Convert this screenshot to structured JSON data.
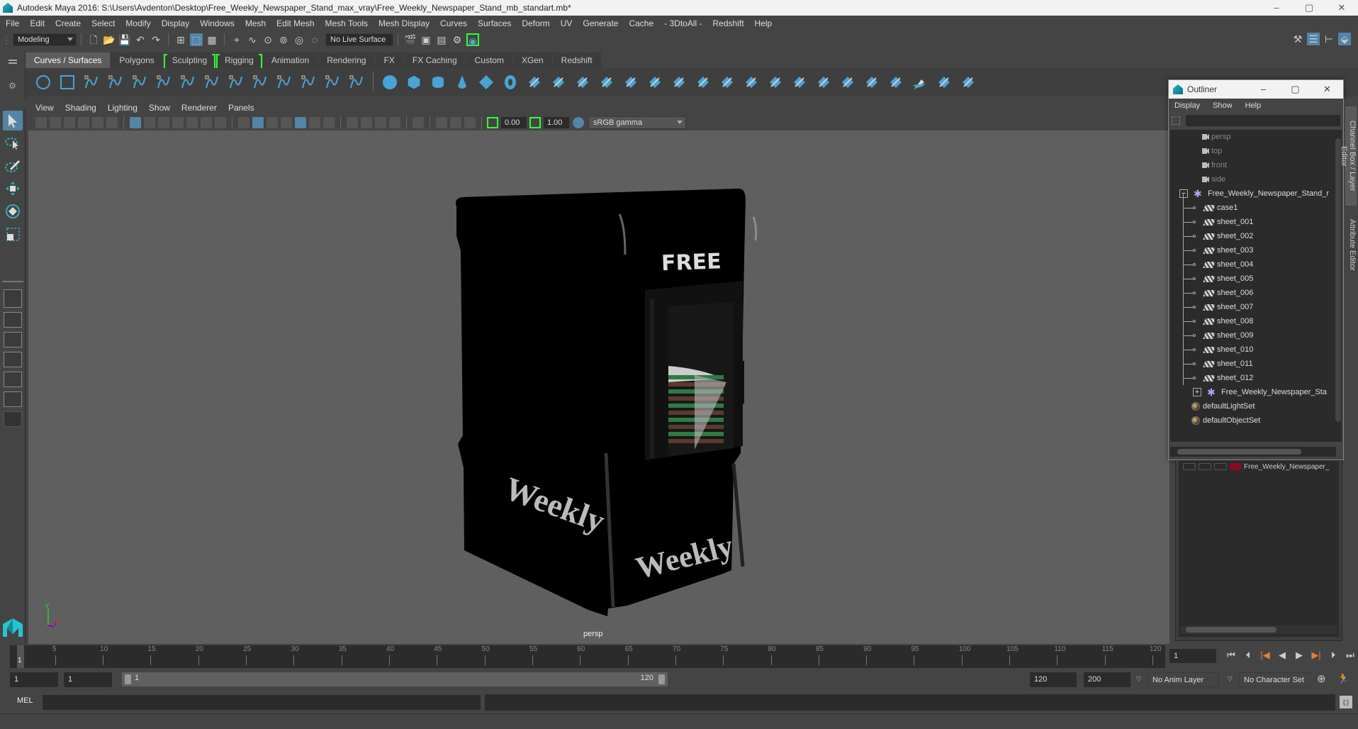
{
  "window": {
    "title": "Autodesk Maya 2016: S:\\Users\\Avdenton\\Desktop\\Free_Weekly_Newspaper_Stand_max_vray\\Free_Weekly_Newspaper_Stand_mb_standart.mb*",
    "minimize": "–",
    "maximize": "▢",
    "close": "✕"
  },
  "menubar": [
    "File",
    "Edit",
    "Create",
    "Select",
    "Modify",
    "Display",
    "Windows",
    "Mesh",
    "Edit Mesh",
    "Mesh Tools",
    "Mesh Display",
    "Curves",
    "Surfaces",
    "Deform",
    "UV",
    "Generate",
    "Cache",
    "- 3DtoAll -",
    "Redshift",
    "Help"
  ],
  "statusline": {
    "mode": "Modeling",
    "live_surface": "No Live Surface"
  },
  "shelf": {
    "tabs": [
      "Curves / Surfaces",
      "Polygons",
      "Sculpting",
      "Rigging",
      "Animation",
      "Rendering",
      "FX",
      "FX Caching",
      "Custom",
      "XGen",
      "Redshift"
    ],
    "active_tab": "Curves / Surfaces",
    "icons": [
      "nurbs-circle",
      "nurbs-square",
      "ep-curve",
      "pencil-curve",
      "cv-curve",
      "arc",
      "curve-edit",
      "curve-attach",
      "curve-detach",
      "bezier",
      "curve-rebuild",
      "curve-insert",
      "curve-cut",
      "curve-fillet",
      "poly-sphere",
      "poly-cube",
      "poly-cylinder",
      "poly-cone",
      "poly-diamond",
      "poly-torus",
      "revolve",
      "loft",
      "planar",
      "extrude",
      "birail",
      "boundary",
      "square",
      "bevel",
      "surface-fillet",
      "intersect",
      "project",
      "trim",
      "untrim",
      "stitch",
      "attach",
      "detach",
      "rebuild",
      "sculpt",
      "surface-cut"
    ]
  },
  "viewport": {
    "menu": [
      "View",
      "Shading",
      "Lighting",
      "Show",
      "Renderer",
      "Panels"
    ],
    "exposure": "0.00",
    "gamma": "1.00",
    "color_space": "sRGB gamma",
    "camera_label": "persp",
    "model_texts": {
      "top": "FREE",
      "left": "Weekly",
      "front": "Weekly"
    }
  },
  "outliner": {
    "title": "Outliner",
    "menu": [
      "Display",
      "Show",
      "Help"
    ],
    "items": [
      {
        "label": "persp",
        "type": "camera",
        "indent": 0
      },
      {
        "label": "top",
        "type": "camera",
        "indent": 0
      },
      {
        "label": "front",
        "type": "camera",
        "indent": 0
      },
      {
        "label": "side",
        "type": "camera",
        "indent": 0
      },
      {
        "label": "Free_Weekly_Newspaper_Stand_r",
        "type": "group",
        "indent": 0,
        "expanded": true
      },
      {
        "label": "case1",
        "type": "mesh",
        "indent": 1
      },
      {
        "label": "sheet_001",
        "type": "mesh",
        "indent": 1
      },
      {
        "label": "sheet_002",
        "type": "mesh",
        "indent": 1
      },
      {
        "label": "sheet_003",
        "type": "mesh",
        "indent": 1
      },
      {
        "label": "sheet_004",
        "type": "mesh",
        "indent": 1
      },
      {
        "label": "sheet_005",
        "type": "mesh",
        "indent": 1
      },
      {
        "label": "sheet_006",
        "type": "mesh",
        "indent": 1
      },
      {
        "label": "sheet_007",
        "type": "mesh",
        "indent": 1
      },
      {
        "label": "sheet_008",
        "type": "mesh",
        "indent": 1
      },
      {
        "label": "sheet_009",
        "type": "mesh",
        "indent": 1
      },
      {
        "label": "sheet_010",
        "type": "mesh",
        "indent": 1
      },
      {
        "label": "sheet_011",
        "type": "mesh",
        "indent": 1
      },
      {
        "label": "sheet_012",
        "type": "mesh",
        "indent": 1
      },
      {
        "label": "Free_Weekly_Newspaper_Sta",
        "type": "group",
        "indent": 1,
        "expanded": false
      },
      {
        "label": "defaultLightSet",
        "type": "set",
        "indent": 0
      },
      {
        "label": "defaultObjectSet",
        "type": "set",
        "indent": 0
      }
    ]
  },
  "side_tabs": [
    "Channel Box / Layer Editor",
    "Attribute Editor"
  ],
  "layer_editor": {
    "layer_name": "Free_Weekly_Newspaper_",
    "layer_color": "#8a0a22"
  },
  "timeline": {
    "ticks": [
      5,
      10,
      15,
      20,
      25,
      30,
      35,
      40,
      45,
      50,
      55,
      60,
      65,
      70,
      75,
      80,
      85,
      90,
      95,
      100,
      105,
      110,
      115,
      120
    ],
    "start": 1,
    "end": 120,
    "current_frame": "1",
    "playback_buttons": [
      "go-to-start",
      "step-back-key",
      "step-back-frame",
      "play-backwards",
      "play-forwards",
      "step-forward-frame",
      "step-forward-key",
      "go-to-end"
    ]
  },
  "range": {
    "start_time": "1",
    "playback_start": "1",
    "slider_start": "1",
    "slider_end": "120",
    "playback_end": "120",
    "end_time": "200",
    "anim_layer": "No Anim Layer",
    "character_set": "No Character Set"
  },
  "cmdline": {
    "label": "MEL"
  }
}
